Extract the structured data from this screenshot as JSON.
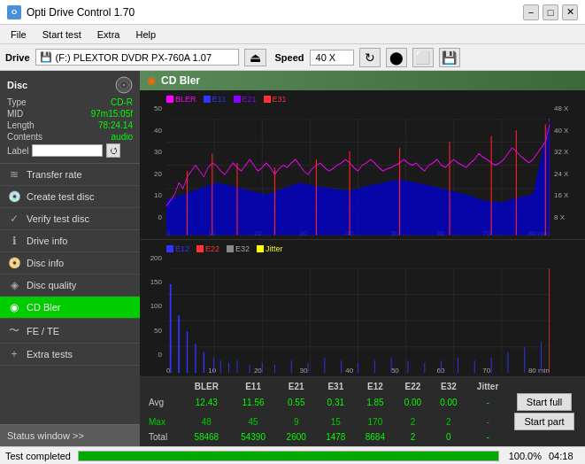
{
  "app": {
    "title": "Opti Drive Control 1.70",
    "icon": "ODC"
  },
  "titlebar": {
    "minimize": "−",
    "restore": "□",
    "close": "✕"
  },
  "menu": {
    "items": [
      "File",
      "Start test",
      "Extra",
      "Help"
    ]
  },
  "drive_bar": {
    "label": "Drive",
    "drive_value": "(F:)  PLEXTOR DVDR  PX-760A 1.07",
    "speed_label": "Speed",
    "speed_value": "40 X",
    "eject_icon": "⏏"
  },
  "disc": {
    "title": "Disc",
    "type_label": "Type",
    "type_value": "CD-R",
    "mid_label": "MID",
    "mid_value": "97m15:05f",
    "length_label": "Length",
    "length_value": "78:24.14",
    "contents_label": "Contents",
    "contents_value": "audio",
    "label_label": "Label"
  },
  "nav": {
    "items": [
      {
        "id": "transfer-rate",
        "label": "Transfer rate",
        "icon": "📊"
      },
      {
        "id": "create-test-disc",
        "label": "Create test disc",
        "icon": "💿"
      },
      {
        "id": "verify-test-disc",
        "label": "Verify test disc",
        "icon": "✓"
      },
      {
        "id": "drive-info",
        "label": "Drive info",
        "icon": "ℹ"
      },
      {
        "id": "disc-info",
        "label": "Disc info",
        "icon": "📀"
      },
      {
        "id": "disc-quality",
        "label": "Disc quality",
        "icon": "⭐"
      },
      {
        "id": "cd-bler",
        "label": "CD Bler",
        "icon": "◉",
        "active": true
      },
      {
        "id": "fe-te",
        "label": "FE / TE",
        "icon": "〜"
      },
      {
        "id": "extra-tests",
        "label": "Extra tests",
        "icon": "+"
      }
    ],
    "status_window": "Status window >>"
  },
  "chart": {
    "title": "CD Bler",
    "icon": "◉",
    "top": {
      "legend": [
        {
          "label": "BLER",
          "color": "#ff00ff"
        },
        {
          "label": "E11",
          "color": "#0000ff"
        },
        {
          "label": "E21",
          "color": "#8800ff"
        },
        {
          "label": "E31",
          "color": "#ff0000"
        }
      ],
      "y_labels": [
        "50",
        "40",
        "30",
        "20",
        "10",
        "0"
      ],
      "y_labels_right": [
        "48 X",
        "40 X",
        "32 X",
        "24 X",
        "16 X",
        "8 X"
      ],
      "x_labels": [
        "0",
        "10",
        "20",
        "30",
        "40",
        "50",
        "60",
        "70",
        "80 min"
      ]
    },
    "bottom": {
      "legend": [
        {
          "label": "E12",
          "color": "#0000ff"
        },
        {
          "label": "E22",
          "color": "#ff0000"
        },
        {
          "label": "E32",
          "color": "#888888"
        },
        {
          "label": "Jitter",
          "color": "#ffff00"
        }
      ],
      "y_labels": [
        "200",
        "150",
        "100",
        "50",
        "0"
      ],
      "x_labels": [
        "0",
        "10",
        "20",
        "30",
        "40",
        "50",
        "60",
        "70",
        "80 min"
      ]
    }
  },
  "stats": {
    "headers": [
      "",
      "BLER",
      "E11",
      "E21",
      "E31",
      "E12",
      "E22",
      "E32",
      "Jitter"
    ],
    "rows": [
      {
        "label": "Avg",
        "values": [
          "12.43",
          "11.56",
          "0.55",
          "0.31",
          "1.85",
          "0.00",
          "0.00",
          "-"
        ]
      },
      {
        "label": "Max",
        "values": [
          "48",
          "45",
          "9",
          "15",
          "170",
          "2",
          "2",
          "-"
        ]
      },
      {
        "label": "Total",
        "values": [
          "58468",
          "54390",
          "2600",
          "1478",
          "8684",
          "2",
          "0",
          "-"
        ]
      }
    ]
  },
  "buttons": {
    "start_full": "Start full",
    "start_part": "Start part"
  },
  "statusbar": {
    "text": "Test completed",
    "progress": 100,
    "progress_text": "100.0%",
    "time": "04:18"
  }
}
